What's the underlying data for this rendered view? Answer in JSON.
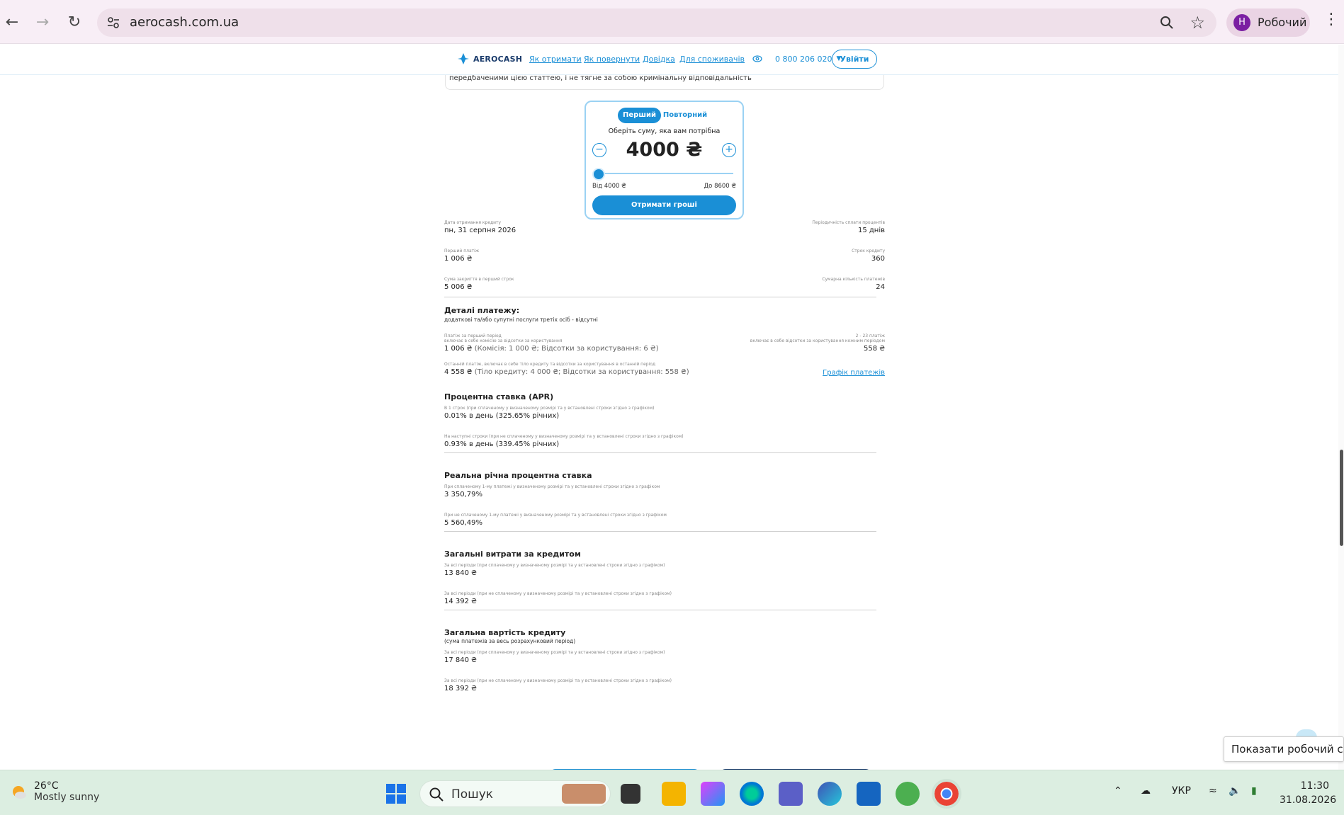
{
  "browser": {
    "url": "aerocash.com.ua",
    "profile_initial": "H",
    "profile_name": "Робочий",
    "colors": {
      "profile_avatar": "#7b1fa2",
      "omnibox": "#efe0ea"
    }
  },
  "site": {
    "brand": "AEROCASH",
    "nav": [
      "Як отримати",
      "Як повернути",
      "Довідка",
      "Для споживачів"
    ],
    "phone": "0 800 206 020",
    "logout": "Увійти",
    "notice_text": "передбаченими цією статтею, і не тягне за собою кримінальну відповідальність",
    "accent": "#1a8fd6"
  },
  "calculator": {
    "tabs": [
      "Перший",
      "Повторний"
    ],
    "active_tab": "Перший",
    "prompt": "Оберіть суму, яка вам потрібна",
    "amount": "4000 ₴",
    "min_label": "Від 4000 ₴",
    "max_label": "До 8600 ₴",
    "slider_fraction": 0,
    "cta": "Отримати гроші"
  },
  "summary": [
    {
      "left_label": "Дата отримання кредиту",
      "left_value": "пн, 31 серпня 2026",
      "right_label": "Періодичність сплати процентів",
      "right_value": "15 днів"
    },
    {
      "left_label": "Перший платіж",
      "left_value": "1 006 ₴",
      "right_label": "Строк кредиту",
      "right_value": "360"
    },
    {
      "left_label": "Сума закриття в перший строк",
      "left_value": "5 006 ₴",
      "right_label": "Сумарна кількість платежів",
      "right_value": "24"
    }
  ],
  "payment_details": {
    "title": "Деталі платежу:",
    "subtitle": "додаткові та/або супутні послуги третіх осіб - відсутні",
    "first_label": "Платіж за перший період",
    "first_label2": "включає в себе комісію за відсотки за користування",
    "first_value": "1 006 ₴",
    "first_note": "(Комісія: 1 000 ₴; Відсотки за користування: 6 ₴)",
    "right_label": "2 - 23 платіж",
    "right_label2": "включає в себе відсотки за користування кожним періодом",
    "right_value": "558 ₴",
    "last_label": "Останній платіж, включає в себе тіло кредиту та відсотки за користування в останній період",
    "last_value": "4 558 ₴",
    "last_note": "(Тіло кредиту: 4 000 ₴; Відсотки за користування: 558 ₴)",
    "schedule_link": "Графік платежів"
  },
  "sections": [
    {
      "title": "Процентна ставка (APR)",
      "items": [
        {
          "label": "В 1 строк (при сплаченому у визначеному розмірі та у встановлені строки згідно з графіком)",
          "value": "0.01% в день (325.65% річних)"
        },
        {
          "label": "На наступні строки (при не сплаченому у визначеному розмірі та у встановлені строки згідно з графіком)",
          "value": "0.93% в день (339.45% річних)"
        }
      ]
    },
    {
      "title": "Реальна річна процентна ставка",
      "items": [
        {
          "label": "При сплаченому 1-му платежі у визначеному розмірі та у встановлені строки згідно з графіком",
          "value": "3 350,79%"
        },
        {
          "label": "При не сплаченому 1-му платежі у визначеному розмірі та у встановлені строки згідно з графіком",
          "value": "5 560,49%"
        }
      ]
    },
    {
      "title": "Загальні витрати за кредитом",
      "items": [
        {
          "label": "За всі періоди (при сплаченому у визначеному розмірі та у встановлені строки згідно з графіком)",
          "value": "13 840 ₴"
        },
        {
          "label": "За всі періоди (при не сплаченому у визначеному розмірі та у встановлені строки згідно з графіком)",
          "value": "14 392 ₴"
        }
      ]
    },
    {
      "title": "Загальна вартість кредиту",
      "subtitle": "(сума платежів за весь розрахунковий період)",
      "items": [
        {
          "label": "За всі періоди (при сплаченому у визначеному розмірі та у встановлені строки згідно з графіком)",
          "value": "17 840 ₴"
        },
        {
          "label": "За всі періоди (при не сплаченому у визначеному розмірі та у встановлені строки згідно з графіком)",
          "value": "18 392 ₴"
        }
      ]
    }
  ],
  "tooltip": "Показати робочий стіл",
  "taskbar": {
    "temperature": "26°C",
    "weather": "Mostly sunny",
    "search_placeholder": "Пошук",
    "lang": "УКР",
    "time": "11:30",
    "date": "31.08.2026"
  }
}
